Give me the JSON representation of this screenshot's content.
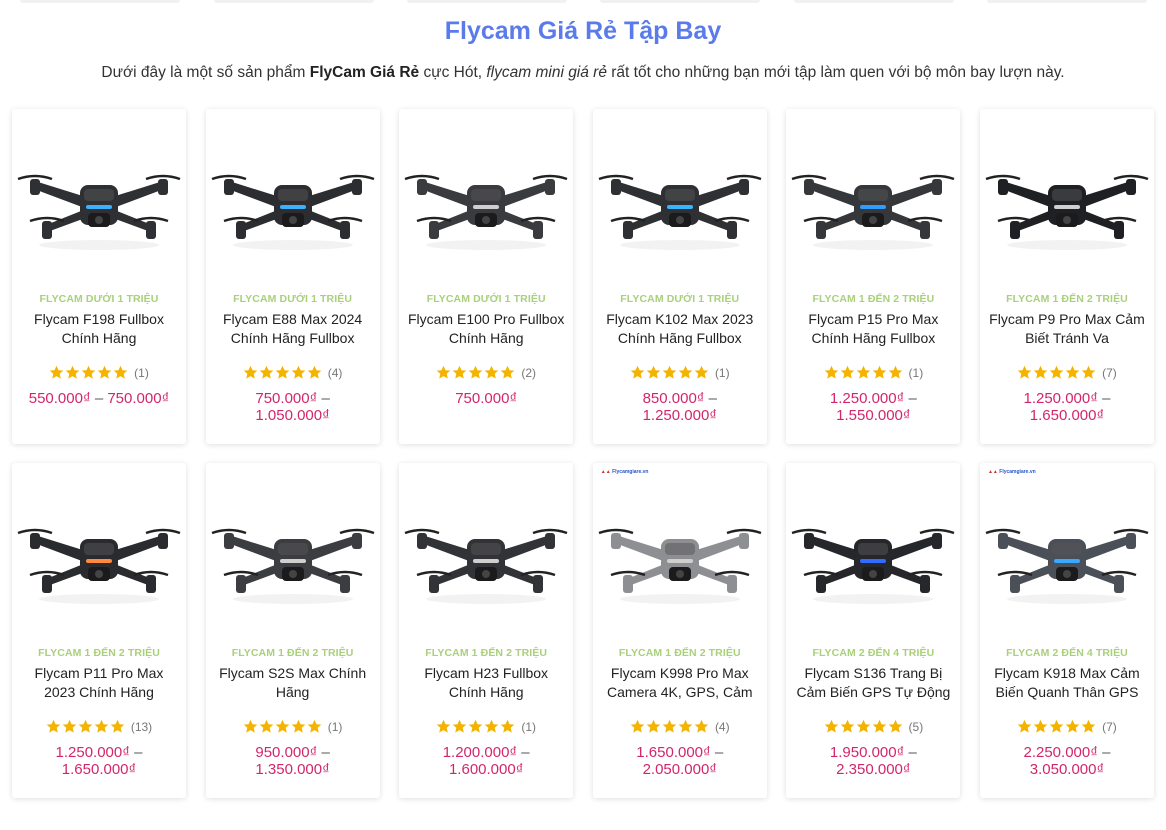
{
  "section": {
    "title": "Flycam Giá Rẻ Tập Bay",
    "intro_part1": "Dưới đây là một số sản phẩm ",
    "intro_bold": "FlyCam Giá Rẻ",
    "intro_part2": " cực Hót, ",
    "intro_italic": "flycam mini giá rẻ",
    "intro_part3": " rất tốt cho những bạn mới tập làm quen với bộ môn bay lượn này."
  },
  "products": [
    {
      "category": "FLYCAM DƯỚI 1 TRIỆU",
      "title": "Flycam F198 Fullbox Chính Hãng",
      "rating_count": "(1)",
      "price_min": "550.000₫",
      "price_max": "750.000₫",
      "price_inline": true,
      "color": "#2f3033",
      "logo": ""
    },
    {
      "category": "FLYCAM DƯỚI 1 TRIỆU",
      "title": "Flycam E88 Max 2024 Chính Hãng Fullbox",
      "rating_count": "(4)",
      "price_min": "750.000₫",
      "price_max": "1.050.000₫",
      "price_inline": false,
      "color": "#2c2d30",
      "logo": ""
    },
    {
      "category": "FLYCAM DƯỚI 1 TRIỆU",
      "title": "Flycam E100 Pro Fullbox Chính Hãng",
      "rating_count": "(2)",
      "price_min": "750.000₫",
      "price_max": "",
      "price_inline": true,
      "color": "#3a3b3e",
      "logo": ""
    },
    {
      "category": "FLYCAM DƯỚI 1 TRIỆU",
      "title": "Flycam K102 Max 2023 Chính Hãng Fullbox",
      "rating_count": "(1)",
      "price_min": "850.000₫",
      "price_max": "1.250.000₫",
      "price_inline": false,
      "color": "#2e3034",
      "logo": ""
    },
    {
      "category": "FLYCAM 1 ĐẾN 2 TRIỆU",
      "title": "Flycam P15 Pro Max Chính Hãng Fullbox",
      "rating_count": "(1)",
      "price_min": "1.250.000₫",
      "price_max": "1.550.000₫",
      "price_inline": false,
      "color": "#35373b",
      "logo": ""
    },
    {
      "category": "FLYCAM 1 ĐẾN 2 TRIỆU",
      "title": "Flycam P9 Pro Max Cảm Biết Tránh Va",
      "rating_count": "(7)",
      "price_min": "1.250.000₫",
      "price_max": "1.650.000₫",
      "price_inline": false,
      "color": "#1f2023",
      "logo": ""
    },
    {
      "category": "FLYCAM 1 ĐẾN 2 TRIỆU",
      "title": "Flycam P11 Pro Max 2023 Chính Hãng",
      "rating_count": "(13)",
      "price_min": "1.250.000₫",
      "price_max": "1.650.000₫",
      "price_inline": false,
      "color": "#2a2b2e",
      "logo": ""
    },
    {
      "category": "FLYCAM 1 ĐẾN 2 TRIỆU",
      "title": "Flycam S2S Max Chính Hãng",
      "rating_count": "(1)",
      "price_min": "950.000₫",
      "price_max": "1.350.000₫",
      "price_inline": false,
      "color": "#3c3d40",
      "logo": ""
    },
    {
      "category": "FLYCAM 1 ĐẾN 2 TRIỆU",
      "title": "Flycam H23 Fullbox Chính Hãng",
      "rating_count": "(1)",
      "price_min": "1.200.000₫",
      "price_max": "1.600.000₫",
      "price_inline": false,
      "color": "#323336",
      "logo": ""
    },
    {
      "category": "FLYCAM 1 ĐẾN 2 TRIỆU",
      "title": "Flycam K998 Pro Max Camera 4K, GPS, Cảm",
      "rating_count": "(4)",
      "price_min": "1.650.000₫",
      "price_max": "2.050.000₫",
      "price_inline": false,
      "color": "#8e8f93",
      "logo": "Flycamgiare.vn"
    },
    {
      "category": "FLYCAM 2 ĐẾN 4 TRIỆU",
      "title": "Flycam S136 Trang Bị Cảm Biến GPS Tự Động",
      "rating_count": "(5)",
      "price_min": "1.950.000₫",
      "price_max": "2.350.000₫",
      "price_inline": false,
      "color": "#26272a",
      "logo": ""
    },
    {
      "category": "FLYCAM 2 ĐẾN 4 TRIỆU",
      "title": "Flycam K918 Max Cảm Biến Quanh Thân GPS",
      "rating_count": "(7)",
      "price_min": "2.250.000₫",
      "price_max": "3.050.000₫",
      "price_inline": false,
      "color": "#4a4f58",
      "logo": "Flycamgiare.vn"
    }
  ],
  "colors": {
    "title": "#5b7bea",
    "category": "#a9d07a",
    "price": "#d2266b",
    "star": "#f5b301"
  },
  "icons": {
    "star": "star-icon",
    "drone": "drone-product-image"
  }
}
